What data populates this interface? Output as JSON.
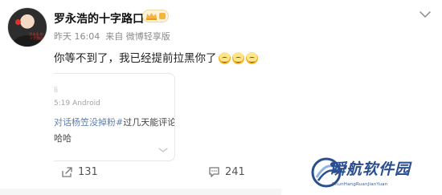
{
  "author": {
    "name": "罗永浩的十字路口",
    "avatar_caption": "罗永浩\n的十字路口"
  },
  "post_meta": {
    "time": "昨天 16:04",
    "source": "来自 微博轻享版"
  },
  "post": {
    "text": "你等不到了，我已经提前拉黑你了"
  },
  "embedded": {
    "mark": "li",
    "meta": "5:19  Android",
    "line1_tag": "对话杨笠没掉粉#",
    "line1_rest": "过几天能评论",
    "line2": "哈哈"
  },
  "actions": {
    "share_count": "131",
    "comment_count": "241"
  },
  "watermark": {
    "title": "瞬航软件园",
    "subtitle": "ShunHangRuanJianYuan"
  },
  "colors": {
    "name": "#111111",
    "meta": "#8a8a8a",
    "tag": "#5b7fb1",
    "watermark": "#2b4e8f"
  },
  "icons": {
    "crown": "crown-badge-icon",
    "more": "more-chevron-icon",
    "share": "share-icon",
    "comment": "comment-icon",
    "emoji": "smile-emoji-icon"
  }
}
